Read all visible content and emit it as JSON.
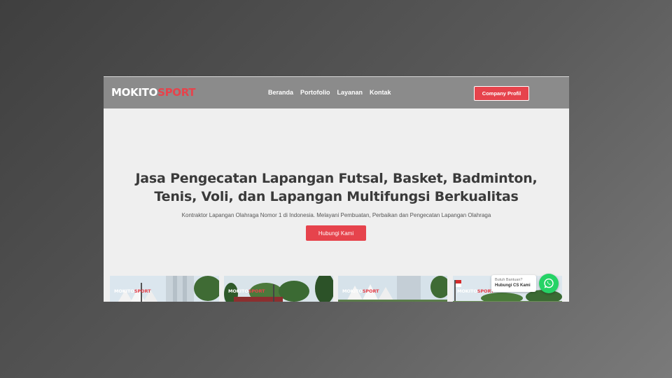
{
  "brand": {
    "part1": "MOKITO",
    "part2": "SPORT",
    "accent": "#e6434c"
  },
  "nav": {
    "items": [
      "Beranda",
      "Portofolio",
      "Layanan",
      "Kontak"
    ]
  },
  "header": {
    "cta_label": "Company Profil"
  },
  "hero": {
    "title_line1": "Jasa Pengecatan Lapangan Futsal, Basket, Badminton,",
    "title_line2": "Tenis, Voli, dan Lapangan Multifungsi Berkualitas",
    "subtitle": "Kontraktor Lapangan Olahraga Nomor 1 di Indonesia. Melayani Pembuatan, Perbaikan dan Pengecatan Lapangan Olahraga",
    "button_label": "Hubungi Kami"
  },
  "gallery": {
    "count": 4
  },
  "chat": {
    "question": "Butuh Bantuan?",
    "action": "Hubungi CS Kami",
    "icon": "whatsapp-icon",
    "color": "#25d366"
  }
}
